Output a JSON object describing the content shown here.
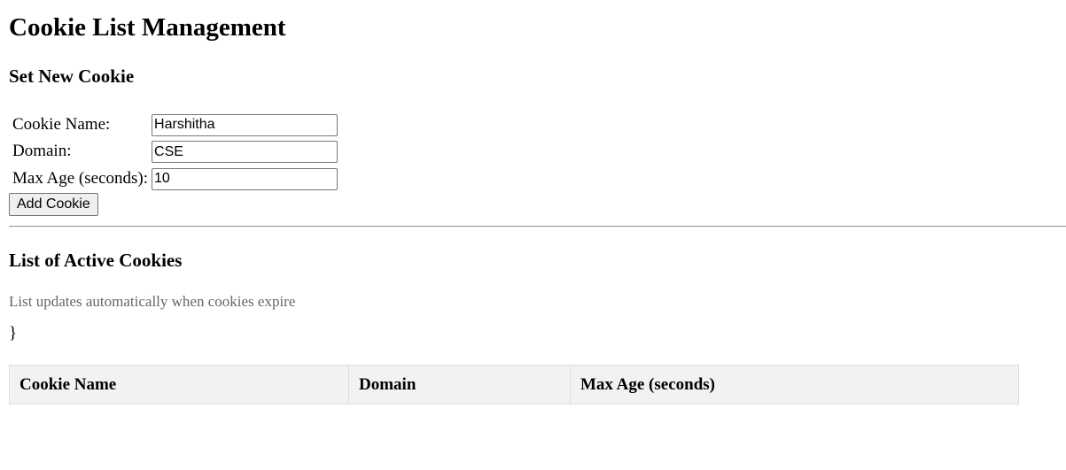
{
  "page": {
    "title": "Cookie List Management"
  },
  "form": {
    "heading": "Set New Cookie",
    "fields": [
      {
        "label": "Cookie Name:",
        "value": "Harshitha"
      },
      {
        "label": "Domain:",
        "value": "CSE"
      },
      {
        "label": "Max Age (seconds):",
        "value": "10"
      }
    ],
    "submit_label": "Add Cookie"
  },
  "list": {
    "heading": "List of Active Cookies",
    "note": "List updates automatically when cookies expire",
    "stray_text": "}",
    "columns": [
      "Cookie Name",
      "Domain",
      "Max Age (seconds)"
    ]
  }
}
